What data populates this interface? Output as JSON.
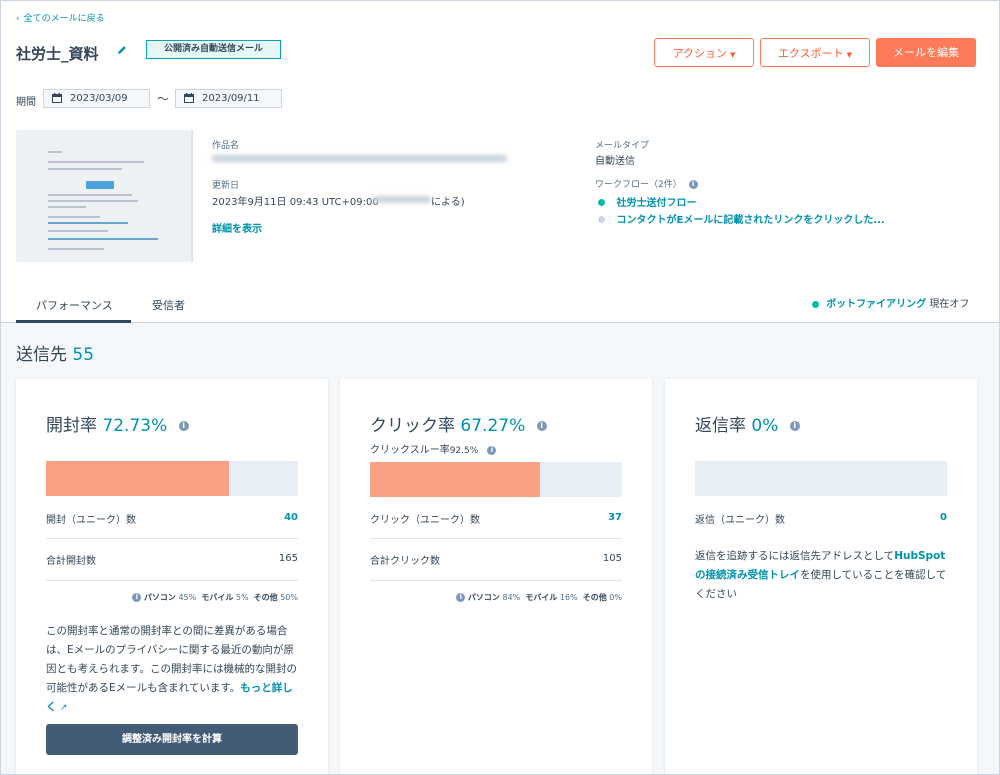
{
  "header": {
    "back_label": "全てのメールに戻る",
    "title": "社労士_資料",
    "status_badge": "公開済み自動送信メール",
    "action_button": "アクション",
    "export_button": "エクスポート",
    "edit_button": "メールを編集"
  },
  "period": {
    "label": "期間",
    "start": "2023/03/09",
    "separator": "～",
    "end": "2023/09/11"
  },
  "details": {
    "name_label": "作品名",
    "updated_label": "更新日",
    "updated_value": "2023年9月11日 09:43 UTC+09:00",
    "updated_by_suffix": "による)",
    "show_details": "詳細を表示",
    "mail_type_label": "メールタイプ",
    "mail_type_value": "自動送信",
    "workflow_label": "ワークフロー（2件）",
    "workflows": [
      {
        "name": "社労士送付フロー",
        "color": "#00bda5"
      },
      {
        "name": "コンタクトがEメールに記載されたリンクをクリックした...",
        "color": "#cbd6e2"
      }
    ]
  },
  "tabs": {
    "performance": "パフォーマンス",
    "recipients": "受信者"
  },
  "bot_filter": {
    "link": "ボットファイアリング",
    "status": " 現在オフ"
  },
  "sent": {
    "label": "送信先",
    "value": "55"
  },
  "open_card": {
    "title": "開封率",
    "rate": "72.73%",
    "bar_fill": 0.7273,
    "unique_label": "開封（ユニーク）数",
    "unique_value": "40",
    "total_label": "合計開封数",
    "total_value": "165",
    "devices": [
      {
        "name": "パソコン",
        "pct": "45%"
      },
      {
        "name": "モバイル",
        "pct": "5%"
      },
      {
        "name": "その他",
        "pct": "50%"
      }
    ],
    "note": "この開封率と通常の開封率との間に差異がある場合は、Eメールのプライバシーに関する最近の動向が原因とも考えられます。この開封率には機械的な開封の可能性があるEメールも含まれています。",
    "note_link": "もっと詳しく",
    "button": "調整済み開封率を計算"
  },
  "click_card": {
    "title": "クリック率",
    "rate": "67.27%",
    "through_label": "クリックスルー率",
    "through_value": "92.5%",
    "bar_fill": 0.6727,
    "unique_label": "クリック（ユニーク）数",
    "unique_value": "37",
    "total_label": "合計クリック数",
    "total_value": "105",
    "devices": [
      {
        "name": "パソコン",
        "pct": "84%"
      },
      {
        "name": "モバイル",
        "pct": "16%"
      },
      {
        "name": "その他",
        "pct": "0%"
      }
    ]
  },
  "reply_card": {
    "title": "返信率",
    "rate": "0%",
    "bar_fill": 0,
    "unique_label": "返信（ユニーク）数",
    "unique_value": "0",
    "note_before": "返信を追跡するには返信先アドレスとして",
    "note_link": "HubSpotの接続済み受信トレイ",
    "note_after": "を使用していることを確認してください"
  }
}
